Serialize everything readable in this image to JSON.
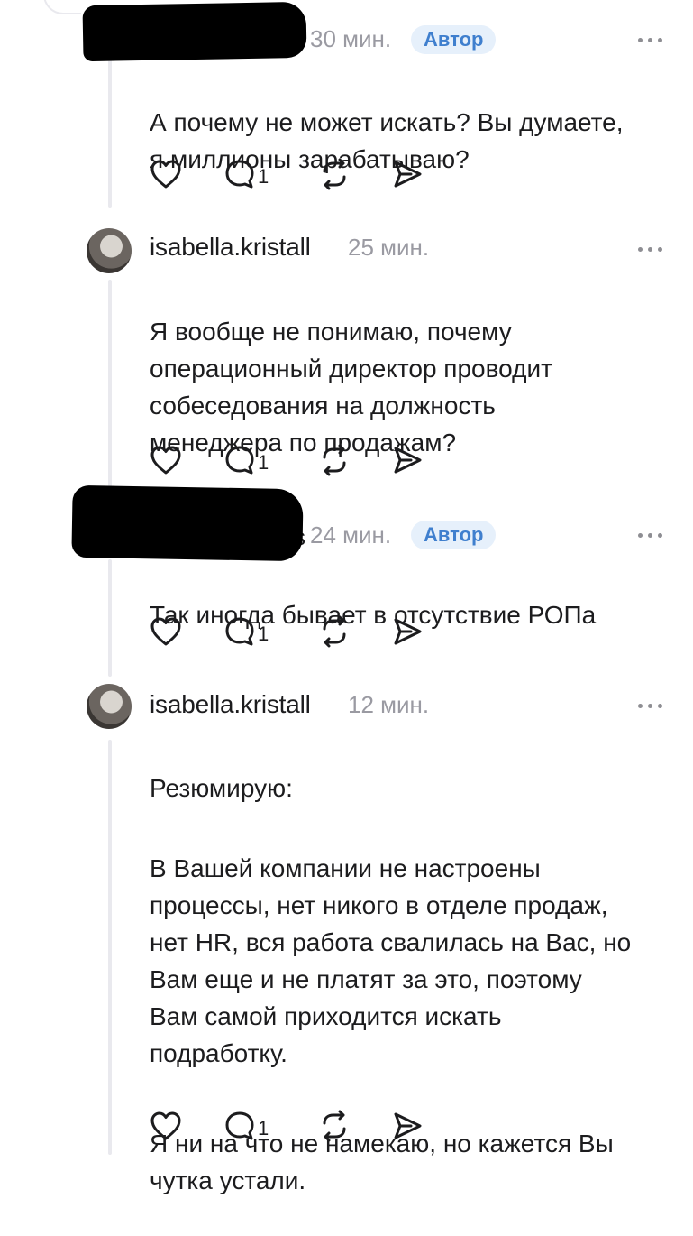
{
  "comments": [
    {
      "username": "",
      "time": "30 мин.",
      "badge": "Автор",
      "paragraphs": [
        "А почему не может искать? Вы думаете,\nя миллионы зарабатываю?"
      ],
      "reply_count": "1"
    },
    {
      "username": "isabella.kristall",
      "time": "25 мин.",
      "badge": "",
      "paragraphs": [
        "Я вообще не понимаю, почему\nоперационный директор проводит\nсобеседования на должность\nменеджера по продажам?"
      ],
      "reply_count": "1"
    },
    {
      "username": "s",
      "time": "24 мин.",
      "badge": "Автор",
      "paragraphs": [
        "Так иногда бывает в отсутствие РОПа"
      ],
      "reply_count": "1"
    },
    {
      "username": "isabella.kristall",
      "time": "12 мин.",
      "badge": "",
      "paragraphs": [
        "Резюмирую:",
        "В Вашей компании не настроены\nпроцессы, нет никого в отделе продаж,\nнет HR, вся работа свалилась на Вас, но\nВам еще и не платят за это, поэтому\nВам самой приходится искать\nподработку.",
        "Я ни на что не намекаю, но кажется Вы\nчутка устали."
      ],
      "reply_count": "1"
    }
  ],
  "icons": [
    "heart-icon",
    "comment-icon",
    "repost-icon",
    "share-icon",
    "more-icon"
  ],
  "colors": {
    "badge_bg": "#e6f0fb",
    "badge_text": "#3f7fce",
    "muted": "#9a9aa2"
  }
}
